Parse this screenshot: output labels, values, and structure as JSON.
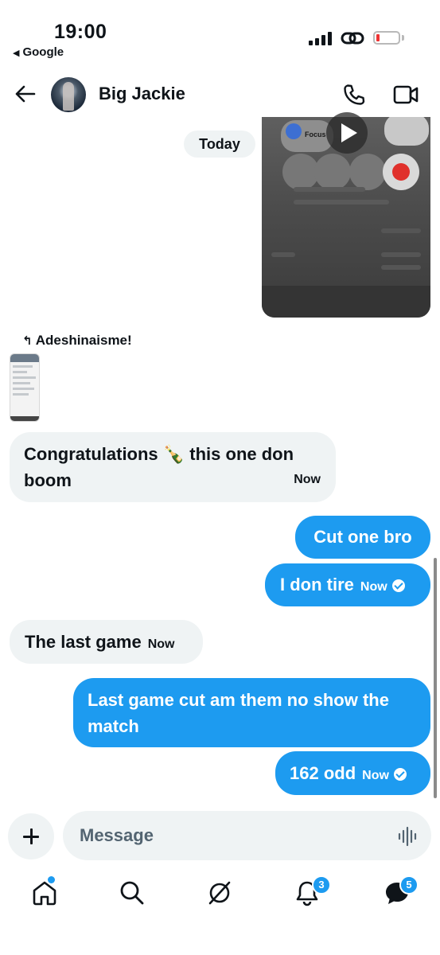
{
  "status_bar": {
    "time": "19:00",
    "back_app": "Google"
  },
  "header": {
    "contact_name": "Big Jackie"
  },
  "conversation": {
    "date_divider": "Today",
    "media_tile": {
      "labels": [
        "Focus"
      ]
    },
    "reply_to_name": "Adeshinaisme!",
    "messages": [
      {
        "direction": "incoming",
        "text": "Congratulations 🍾 this one don boom",
        "time": "Now"
      },
      {
        "direction": "outgoing",
        "text": "Cut one bro",
        "time": ""
      },
      {
        "direction": "outgoing",
        "text": "I don tire",
        "time": "Now",
        "read": true
      },
      {
        "direction": "incoming",
        "text": "The last game",
        "time": "Now"
      },
      {
        "direction": "outgoing",
        "text": "Last game cut am them no show the match",
        "time": ""
      },
      {
        "direction": "outgoing",
        "text": "162 odd",
        "time": "Now",
        "read": true
      }
    ]
  },
  "composer": {
    "placeholder": "Message"
  },
  "bottom_nav": {
    "notifications_badge": "3",
    "messages_badge": "5"
  },
  "colors": {
    "accent": "#1d9bf0",
    "incoming_bubble": "#eff3f4",
    "text": "#0f1419",
    "muted": "#536471"
  }
}
